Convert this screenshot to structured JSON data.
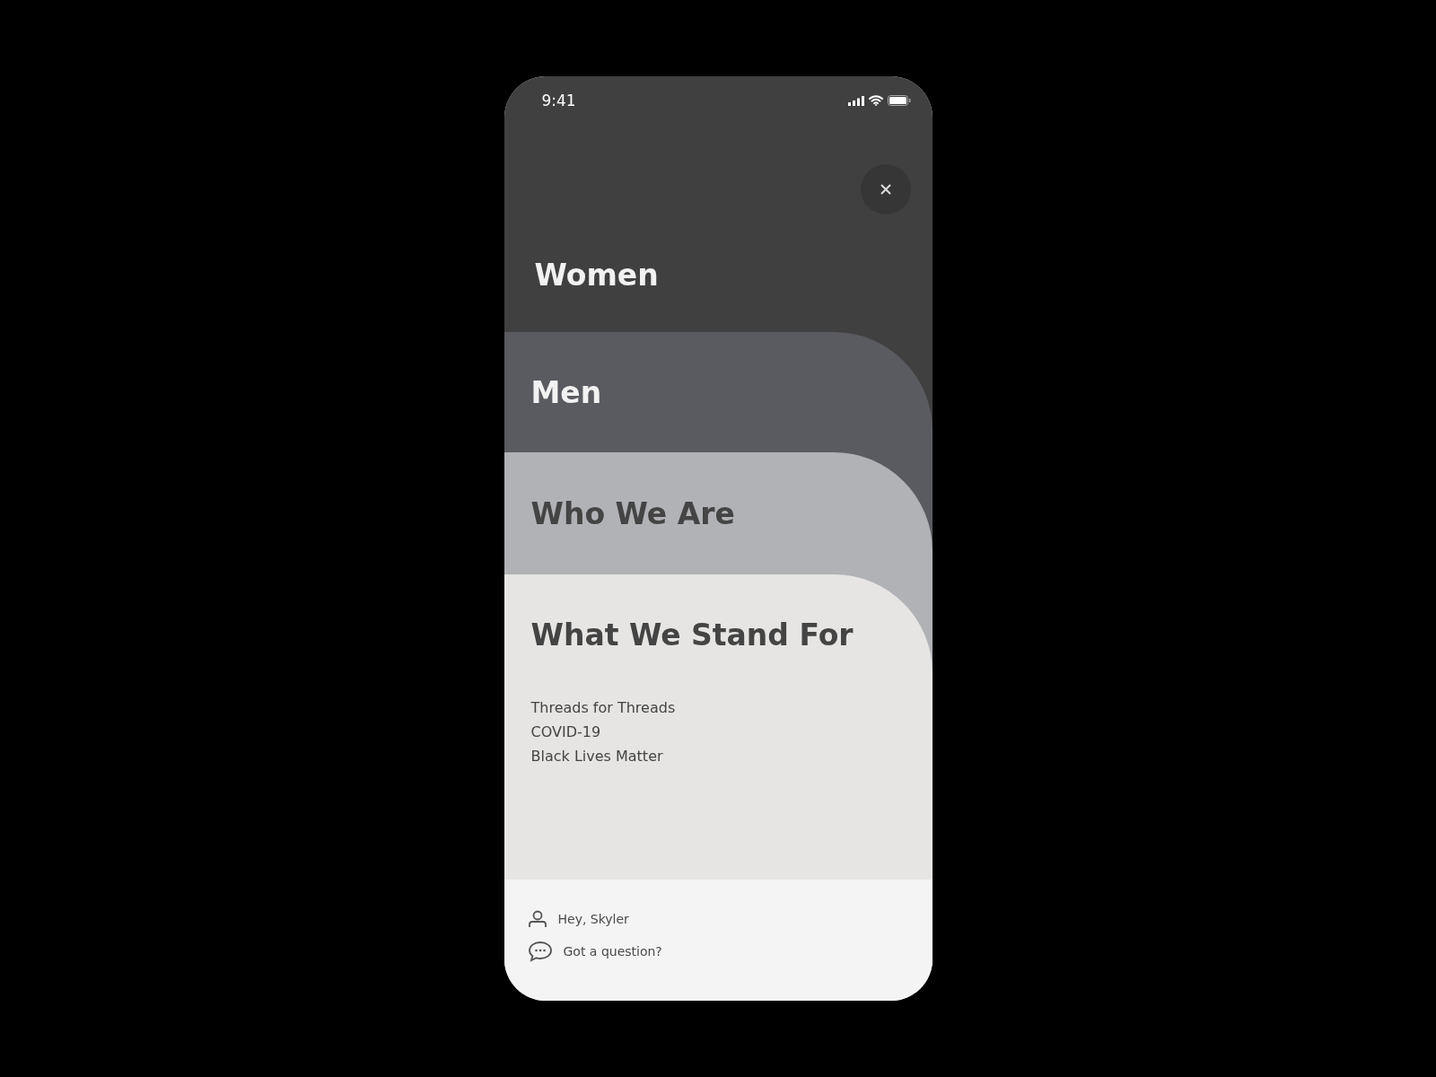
{
  "status_bar": {
    "time": "9:41"
  },
  "menu": [
    {
      "label": "Women",
      "color": "#404040"
    },
    {
      "label": "Men",
      "color": "#5a5b60"
    },
    {
      "label": "Who We Are",
      "color": "#b1b2b6"
    },
    {
      "label": "What We Stand For",
      "color": "#e6e5e3",
      "links": [
        "Threads for Threads",
        "COVID-19",
        "Black Lives Matter"
      ]
    }
  ],
  "footer": [
    {
      "kind": "account",
      "label": "Hey, Skyler"
    },
    {
      "kind": "chat",
      "label": "Got a question?"
    }
  ]
}
